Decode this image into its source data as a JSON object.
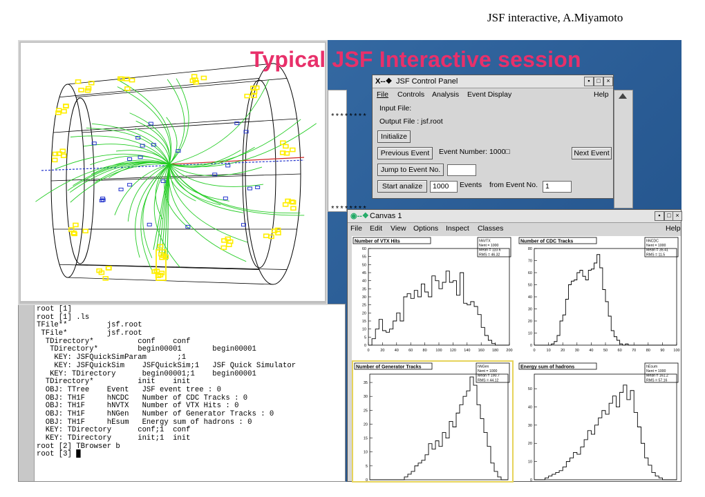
{
  "header": {
    "text": "JSF interactive, A.Miyamoto"
  },
  "slide": {
    "title": "Typical JSF Interactive session"
  },
  "colors": {
    "title": "#e8306a",
    "desktop": "#3a6ea5",
    "histogram": "#000000",
    "detector": "#000000",
    "tracks": "#22cc22",
    "hits": "#ffee00"
  },
  "terminal": {
    "stars_top": "********",
    "stars_bottom": "********",
    "lines": [
      "root [1]",
      "root [1] .ls",
      "TFile**         jsf.root",
      " TFile*         jsf.root",
      "  TDirectory*          conf    conf",
      "   TDirectory*         begin00001       begin00001",
      "    KEY: JSFQuickSimParam       ;1",
      "    KEY: JSFQuickSim    JSFQuickSim;1   JSF Quick Simulator",
      "   KEY: TDirectory      begin00001;1    begin00001",
      "  TDirectory*          init    init",
      "  OBJ: TTree    Event   JSF event tree : 0",
      "  OBJ: TH1F     hNCDC   Number of CDC Tracks : 0",
      "  OBJ: TH1F     hNVTX   Number of VTX Hits : 0",
      "  OBJ: TH1F     hNGen   Number of Generator Tracks : 0",
      "  OBJ: TH1F     hEsum   Energy sum of hadrons : 0",
      "  KEY: TDirectory      conf;1  conf",
      "  KEY: TDirectory      init;1  init",
      "root [2] TBrowser b",
      "root [3] █"
    ]
  },
  "control_panel": {
    "title": "JSF Control Panel",
    "title_prefix": "X-‑❖",
    "menu": [
      "File",
      "Controls",
      "Analysis",
      "Event Display"
    ],
    "help": "Help",
    "input_file_label": "Input File:",
    "output_file_label": "Output File :  jsf.root",
    "initialize_button": "Initialize",
    "previous_event_button": "Previous Event",
    "event_number_label": "Event Number: 1000□",
    "next_event_button": "Next Event",
    "jump_button": "Jump to Event No.",
    "jump_value": "",
    "start_button": "Start analize",
    "events_value": "1000",
    "events_label": "Events",
    "from_event_label": "from Event No.",
    "from_event_value": "1"
  },
  "canvas_window": {
    "title": "Canvas 1",
    "menu": [
      "File",
      "Edit",
      "View",
      "Options",
      "Inspect",
      "Classes"
    ],
    "help": "Help"
  },
  "chart_data": [
    {
      "type": "bar",
      "title": "Number of VTX Hits",
      "stats": [
        "hNVTX",
        "Nent = 1000",
        "Mean = 110.6",
        "RMS = 46.32"
      ],
      "xlim": [
        0,
        200
      ],
      "ylim": [
        0,
        60
      ],
      "xticks": [
        0,
        20,
        40,
        60,
        80,
        100,
        120,
        140,
        160,
        180,
        200
      ],
      "yticks": [
        0,
        5,
        10,
        15,
        20,
        25,
        30,
        35,
        40,
        45,
        50,
        55,
        60
      ],
      "bin_width": 5,
      "values": [
        0,
        4,
        10,
        16,
        9,
        8,
        10,
        15,
        20,
        15,
        30,
        32,
        29,
        34,
        30,
        38,
        33,
        30,
        43,
        40,
        35,
        39,
        46,
        39,
        40,
        31,
        45,
        26,
        25,
        27,
        24,
        19,
        11,
        6,
        3,
        1,
        0,
        0,
        0,
        0
      ]
    },
    {
      "type": "bar",
      "title": "Number of CDC Tracks",
      "stats": [
        "hNCDC",
        "Nent = 1000",
        "Mean = 35.41",
        "RMS = 11.5"
      ],
      "xlim": [
        0,
        100
      ],
      "ylim": [
        0,
        80
      ],
      "xticks": [
        0,
        10,
        20,
        30,
        40,
        50,
        60,
        70,
        80,
        90,
        100
      ],
      "yticks": [
        0,
        10,
        20,
        30,
        40,
        50,
        60,
        70,
        80
      ],
      "bin_width": 2,
      "values": [
        0,
        0,
        0,
        0,
        0,
        0,
        1,
        3,
        8,
        20,
        25,
        38,
        50,
        53,
        54,
        60,
        62,
        57,
        54,
        62,
        63,
        68,
        75,
        64,
        46,
        36,
        24,
        12,
        7,
        4,
        1,
        0,
        1,
        0,
        0,
        0,
        0,
        0,
        0,
        0,
        0,
        0,
        0,
        0,
        0,
        0,
        0,
        0,
        0,
        0
      ]
    },
    {
      "type": "bar",
      "title": "Number of Generator Tracks",
      "stats": [
        "hNGen",
        "Nent = 1000",
        "Mean = 190.7",
        "RMS = 44.12"
      ],
      "xlim": [
        0,
        300
      ],
      "ylim": [
        0,
        38
      ],
      "yticks": [
        0,
        5,
        10,
        15,
        20,
        25,
        30,
        35
      ],
      "bin_width": 7.5,
      "values": [
        0,
        0,
        0,
        0,
        0,
        0,
        0,
        0,
        0,
        0,
        1,
        2,
        3,
        5,
        6,
        7,
        9,
        13,
        11,
        14,
        12,
        17,
        15,
        21,
        19,
        24,
        27,
        30,
        32,
        37,
        34,
        27,
        22,
        17,
        12,
        6,
        3,
        1,
        0,
        0
      ]
    },
    {
      "type": "bar",
      "title": "Energy sum of hadrons",
      "stats": [
        "hEsum",
        "Nent = 1000",
        "Mean = 161.2",
        "RMS = 57.16"
      ],
      "xlim": [
        0,
        300
      ],
      "ylim": [
        0,
        58
      ],
      "yticks": [
        0,
        10,
        20,
        30,
        40,
        50
      ],
      "bin_width": 7.5,
      "values": [
        0,
        0,
        0,
        1,
        2,
        3,
        4,
        5,
        7,
        10,
        12,
        15,
        14,
        18,
        22,
        27,
        25,
        30,
        34,
        38,
        36,
        42,
        46,
        40,
        48,
        52,
        44,
        49,
        37,
        29,
        20,
        12,
        8,
        4,
        2,
        1,
        0,
        0,
        0,
        0
      ]
    }
  ]
}
